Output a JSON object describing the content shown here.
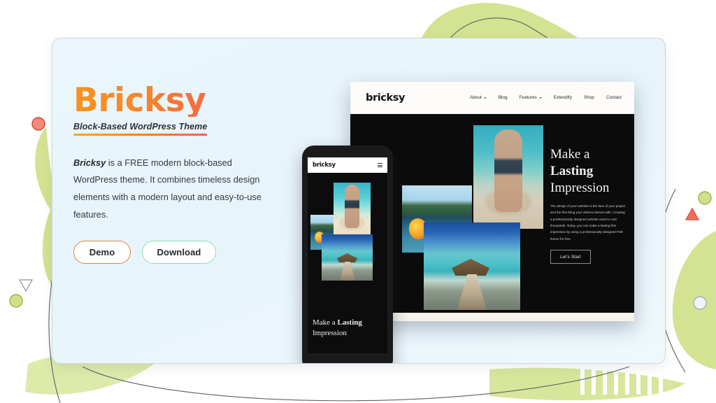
{
  "page": {
    "card_bg": "#e8f4fb",
    "accent_orange": "#f7941e",
    "accent_red": "#f24a5a",
    "accent_green": "#8fdcb4"
  },
  "hero": {
    "title": "Bricksy",
    "tagline": "Block-Based WordPress Theme",
    "intro_lead": "Bricksy",
    "intro_rest": " is a FREE modern block-based WordPress theme. It combines timeless design elements with a modern layout and easy-to-use features.",
    "buttons": {
      "demo": "Demo",
      "download": "Download"
    }
  },
  "desktop_mockup": {
    "logo": "bricksy",
    "nav": [
      {
        "label": "About",
        "has_caret": true
      },
      {
        "label": "Blog",
        "has_caret": false
      },
      {
        "label": "Features",
        "has_caret": true
      },
      {
        "label": "Extendify",
        "has_caret": false
      },
      {
        "label": "Shop",
        "has_caret": false
      },
      {
        "label": "Contact",
        "has_caret": false
      }
    ],
    "headline_light": "Make a ",
    "headline_bold": "Lasting",
    "headline_line2": "Impression",
    "paragraph": "The design of your website is the face of your project and the first thing your visitors interact with. Creating a professionally designed website used to cost thousands. Today, you can make a lasting first impression by using a professionally designed FSE theme for free.",
    "cta": "Let's Start",
    "photos": [
      {
        "name": "photo-person-beach"
      },
      {
        "name": "photo-lake-kayak"
      },
      {
        "name": "photo-overwater-pier"
      }
    ]
  },
  "mobile_mockup": {
    "logo": "bricksy",
    "menu_icon": "hamburger-icon",
    "headline_light": "Make a ",
    "headline_bold": "Lasting",
    "headline_line2": "Impression"
  },
  "decorations": {
    "green": "#cfe08a",
    "green_soft": "#d6e69a",
    "coral": "#f2705c",
    "coral_light": "#f58a78",
    "blue_circle": "#e8eef8",
    "line": "#5c6066"
  }
}
